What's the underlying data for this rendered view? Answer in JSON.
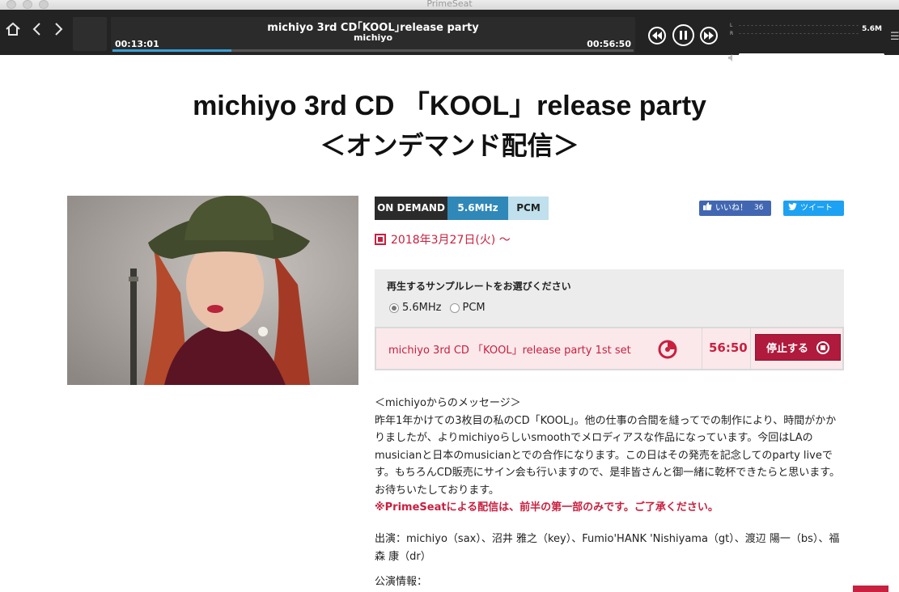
{
  "window": {
    "title": "PrimeSeat"
  },
  "player": {
    "track_title": "michiyo 3rd CD｢KOOL｣release party",
    "artist": "michiyo",
    "elapsed": "00:13:01",
    "total": "00:56:50",
    "progress": 0.229,
    "sample_rate_readout": "5.6M",
    "meter_labels": [
      "L",
      "R"
    ],
    "volume": 1.0,
    "icons": {
      "home": "home-icon",
      "back": "chevron-left-icon",
      "forward": "chevron-right-icon",
      "rewind": "rewind-icon",
      "pause": "pause-icon",
      "fast_forward": "fast-forward-icon",
      "volume": "volume-icon",
      "menu": "menu-icon"
    }
  },
  "page": {
    "title_line1": "michiyo 3rd CD 「KOOL」release party",
    "title_line2": "＜オンデマンド配信＞",
    "tags": [
      "ON DEMAND",
      "5.6MHz",
      "PCM"
    ],
    "like_label": "いいね！",
    "like_count": "36",
    "tweet_label": "ツイート",
    "date": "2018年3月27日(火) 〜",
    "rate_heading": "再生するサンプルレートをお選びください",
    "rate_options": [
      "5.6MHz",
      "PCM"
    ],
    "selected_rate": "5.6MHz",
    "play_item_title": "michiyo 3rd CD 「KOOL」release party 1st set",
    "play_item_duration": "56:50",
    "stop_label": "停止する",
    "message_heading": "＜michiyoからのメッセージ＞",
    "message_body": "昨年1年かけての3枚目の私のCD「KOOL」。他の仕事の合間を縫ってでの制作により、時間がかかりましたが、よりmichiyoらしいsmoothでメロディアスな作品になっています。今回はLAのmusicianと日本のmusicianとでの合作になります。この日はその発売を記念してのparty liveです。もちろんCD販売にサイン会も行いますので、是非皆さんと御一緒に乾杯できたらと思います。お待ちいたしております。",
    "message_notice": "※PrimeSeatによる配信は、前半の第一部のみです。ご了承ください。",
    "performers": "出演：michiyo（sax）、沼井 雅之（key）、Fumio'HANK 'Nishiyama（gt）、渡辺 陽一（bs）、福森 康（dr）",
    "info_label": "公演情報："
  },
  "colors": {
    "accent": "#c8203f",
    "player_bg": "#232323",
    "progress": "#3aa0d8",
    "tag_dark": "#2b2b2b",
    "tag_blue": "#2f88b8",
    "tag_light": "#bfe0ec",
    "facebook": "#4267b2",
    "twitter": "#1da1f2"
  }
}
